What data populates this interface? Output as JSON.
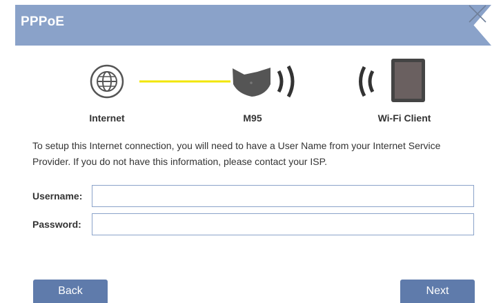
{
  "header": {
    "title": "PPPoE"
  },
  "close_icon": "close-icon",
  "diagram": {
    "internet_label": "Internet",
    "router_label": "M95",
    "client_label": "Wi-Fi Client",
    "link_color": "#f2e600"
  },
  "description": "To setup this Internet connection, you will need to have a User Name from your Internet Service Provider. If you do not have this information, please contact your ISP.",
  "form": {
    "username_label": "Username:",
    "username_value": "",
    "password_label": "Password:",
    "password_value": ""
  },
  "buttons": {
    "back": "Back",
    "next": "Next"
  },
  "colors": {
    "accent": "#8aa2c9",
    "button": "#5f7bab"
  }
}
